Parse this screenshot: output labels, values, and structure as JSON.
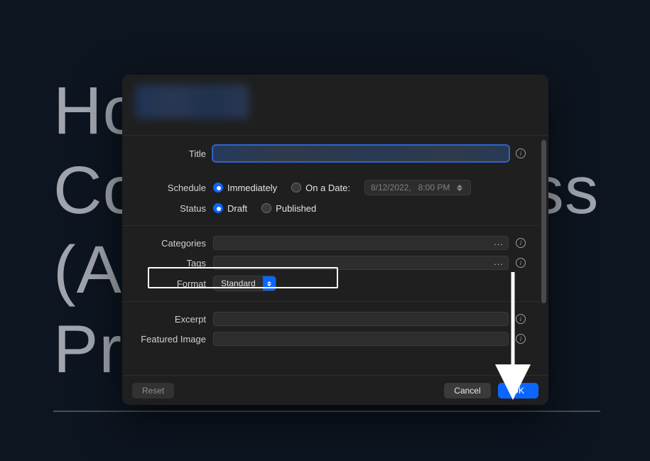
{
  "background_text": "Ho\nCo                    ss\n(A\nPr",
  "dialog": {
    "labels": {
      "title": "Title",
      "schedule": "Schedule",
      "status": "Status",
      "categories": "Categories",
      "tags": "Tags",
      "format": "Format",
      "excerpt": "Excerpt",
      "featured_image": "Featured Image"
    },
    "schedule": {
      "options": {
        "immediately": "Immediately",
        "on_a_date": "On a Date:"
      },
      "selected": "immediately",
      "date": "8/12/2022,",
      "time": "8:00 PM"
    },
    "status": {
      "options": {
        "draft": "Draft",
        "published": "Published"
      },
      "selected": "draft"
    },
    "format": {
      "selected": "Standard"
    },
    "wells": {
      "ellipsis": "..."
    },
    "buttons": {
      "reset": "Reset",
      "cancel": "Cancel",
      "ok": "OK"
    }
  },
  "icons": {
    "info_glyph": "i"
  }
}
